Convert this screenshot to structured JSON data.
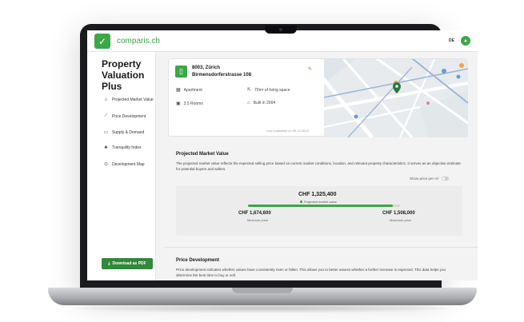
{
  "brand": {
    "logo_text": "comparis.ch",
    "language": "DE",
    "accent": "#3aa845",
    "button_green": "#2f8a3b"
  },
  "sidebar": {
    "title": "Property Valuation Plus",
    "items": [
      {
        "label": "Projected Market Value",
        "icon": "tag-icon"
      },
      {
        "label": "Price Development",
        "icon": "trend-chart-icon"
      },
      {
        "label": "Supply & Demand",
        "icon": "calendar-icon"
      },
      {
        "label": "Tranquility Index",
        "icon": "tree-icon"
      },
      {
        "label": "Development Map",
        "icon": "map-pin-icon"
      }
    ],
    "download_label": "Download as PDF"
  },
  "property": {
    "city": "8003, Zürich",
    "street": "Birmensdorferstrasse 108",
    "type": "Apartment",
    "living_space": "70m² of living space",
    "rooms": "3.5 Rooms",
    "built": "Built in 2004",
    "last_evaluated": "Last evaluated on 05.10.2024"
  },
  "projected": {
    "title": "Projected Market Value",
    "description": "The projected market value reflects the expected selling price based on current market conditions, location, and relevant property characteristics. It serves as an objective estimate for potential buyers and sellers.",
    "toggle_label": "Show price per m²",
    "value": "CHF 1,325,400",
    "value_label": "Projected market value",
    "min_value": "CHF 1,674,600",
    "min_label": "Minimum price",
    "max_value": "CHF 1,508,000",
    "max_label": "Maximum price",
    "range_fill_fraction": 0.95
  },
  "price_development": {
    "title": "Price Development",
    "description": "Price development indicates whether values have consistently risen or fallen. This allows you to better assess whether a further increase is expected. This data helps you determine the best time to buy or sell."
  }
}
